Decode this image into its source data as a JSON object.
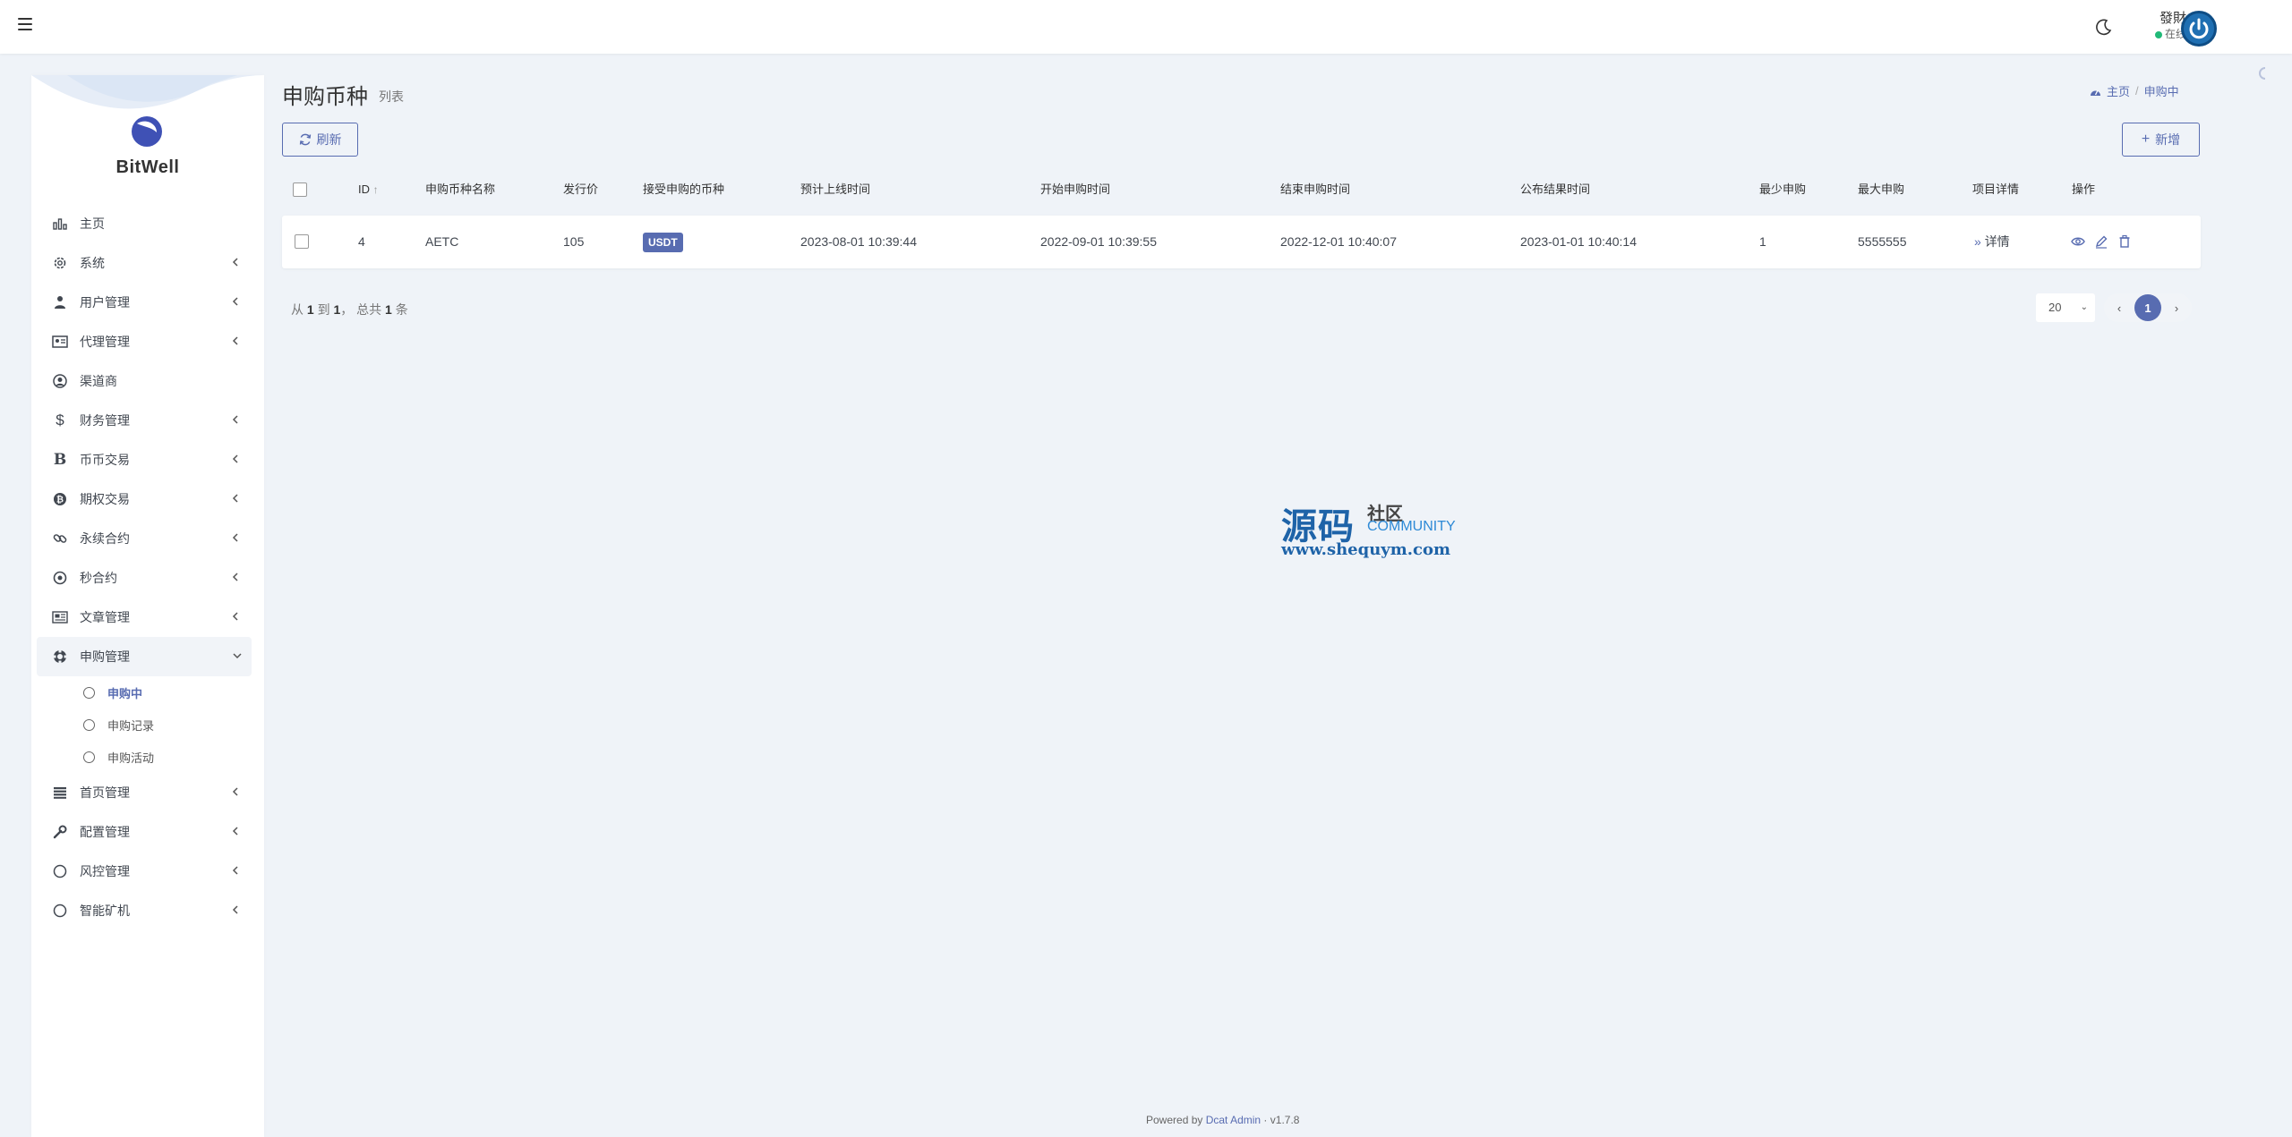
{
  "topbar": {
    "user_name": "發財",
    "user_status": "在线"
  },
  "brand": {
    "name": "BitWell"
  },
  "sidebar": {
    "items": [
      {
        "label": "主页",
        "icon": "bar-chart-icon",
        "has_children": false
      },
      {
        "label": "系统",
        "icon": "gear-icon",
        "has_children": true
      },
      {
        "label": "用户管理",
        "icon": "user-tie-icon",
        "has_children": true
      },
      {
        "label": "代理管理",
        "icon": "id-card-icon",
        "has_children": true
      },
      {
        "label": "渠道商",
        "icon": "user-circle-icon",
        "has_children": false
      },
      {
        "label": "财务管理",
        "icon": "dollar-icon",
        "has_children": true
      },
      {
        "label": "币币交易",
        "icon": "bitcoin-b-icon",
        "has_children": true
      },
      {
        "label": "期权交易",
        "icon": "bitcoin-circle-icon",
        "has_children": true
      },
      {
        "label": "永续合约",
        "icon": "link-icon",
        "has_children": true
      },
      {
        "label": "秒合约",
        "icon": "dot-circle-icon",
        "has_children": true
      },
      {
        "label": "文章管理",
        "icon": "newspaper-icon",
        "has_children": true
      }
    ],
    "open_item": {
      "label": "申购管理",
      "icon": "life-ring-icon"
    },
    "submenu": [
      {
        "label": "申购中",
        "active": true
      },
      {
        "label": "申购记录",
        "active": false
      },
      {
        "label": "申购活动",
        "active": false
      }
    ],
    "items_after": [
      {
        "label": "首页管理",
        "icon": "list-icon"
      },
      {
        "label": "配置管理",
        "icon": "wrench-icon"
      },
      {
        "label": "风控管理",
        "icon": "circle-icon"
      },
      {
        "label": "智能矿机",
        "icon": "circle-icon"
      }
    ]
  },
  "page": {
    "title": "申购币种",
    "subtitle": "列表",
    "breadcrumb": [
      "主页",
      "申购中"
    ]
  },
  "toolbar": {
    "refresh_label": "刷新",
    "new_label": "新增"
  },
  "table": {
    "columns": [
      "ID",
      "申购币种名称",
      "发行价",
      "接受申购的币种",
      "预计上线时间",
      "开始申购时间",
      "结束申购时间",
      "公布结果时间",
      "最少申购",
      "最大申购",
      "项目详情",
      "操作"
    ],
    "rows": [
      {
        "id": "4",
        "name": "AETC",
        "price": "105",
        "currency": "USDT",
        "launch_time": "2023-08-01 10:39:44",
        "start_time": "2022-09-01 10:39:55",
        "end_time": "2022-12-01 10:40:07",
        "result_time": "2023-01-01 10:40:14",
        "min": "1",
        "max": "5555555",
        "detail_label": "详情"
      }
    ]
  },
  "pager": {
    "prefix": "从",
    "from": "1",
    "to_label": "到",
    "to": "1",
    "total_label": "， 总共",
    "total": "1",
    "suffix": "条",
    "per_page": "20",
    "current_page": "1"
  },
  "watermark": {
    "big": "源码",
    "small": "社区",
    "community": "COMMUNITY",
    "url": "www.shequym.com"
  },
  "footer": {
    "powered_by": "Powered by",
    "product": "Dcat Admin",
    "sep": "·",
    "version": "v1.7.8"
  },
  "colors": {
    "primary": "#586cb1",
    "background": "#eff3f8",
    "online": "#21b978"
  }
}
